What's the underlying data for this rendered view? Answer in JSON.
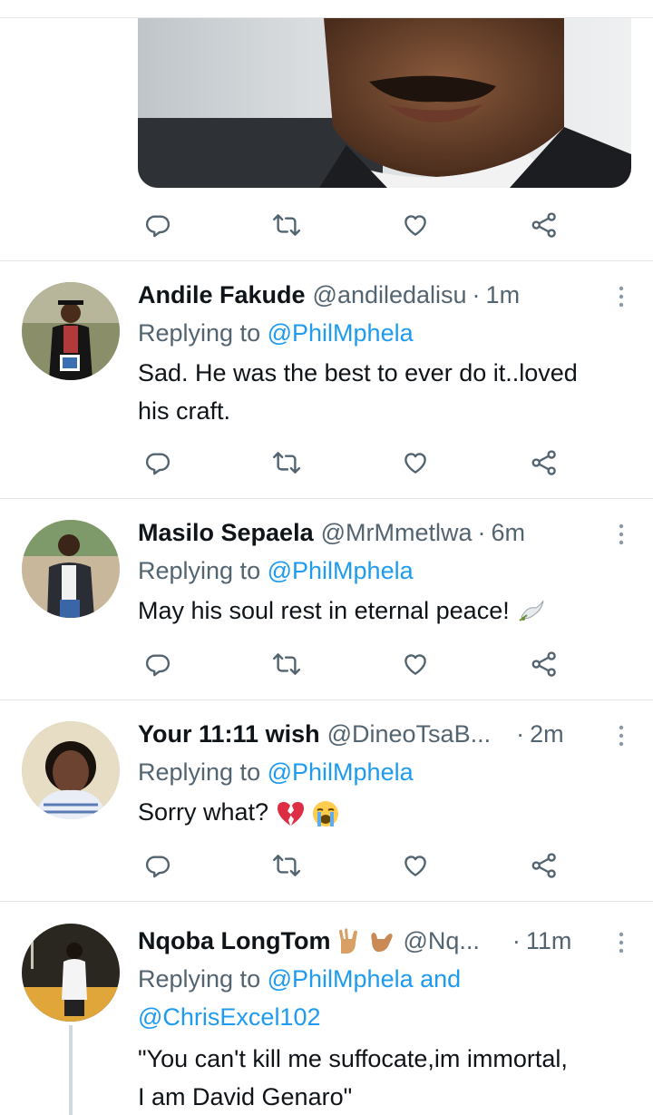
{
  "tweets": [
    {
      "name": "Andile Fakude",
      "handle": "@andiledalisu",
      "sep": "·",
      "time": "1m",
      "replying_prefix": "Replying to",
      "replying_to": "@PhilMphela",
      "text_line1": "Sad. He was the best to ever do it..loved",
      "text_line2": "his craft."
    },
    {
      "name": "Masilo Sepaela",
      "handle": "@MrMmetlwa",
      "sep": "·",
      "time": "6m",
      "replying_prefix": "Replying to",
      "replying_to": "@PhilMphela",
      "text_line1": "May his soul rest in eternal peace!",
      "emoji": "dove-emoji"
    },
    {
      "name": "Your 11:11 wish",
      "handle": "@DineoTsaB...",
      "sep": "·",
      "time": "2m",
      "replying_prefix": "Replying to",
      "replying_to": "@PhilMphela",
      "text_line1": "Sorry what?",
      "emoji": "broken-heart-and-crying-face-emoji"
    },
    {
      "name": "Nqoba LongTom",
      "handle": "@Nq...",
      "sep": "·",
      "time": "11m",
      "replying_prefix": "Replying to",
      "replying_to": "@PhilMphela",
      "replying_and": "and",
      "replying_to_2": "@ChrisExcel102",
      "text_line1": "\"You can't kill me suffocate,im immortal,",
      "text_line2": "I am David Genaro\"",
      "emoji": "hand-gesture-emoji"
    }
  ],
  "colors": {
    "accent": "#1d9bf0",
    "secondary_text": "#536471",
    "primary_text": "#0f1419",
    "divider": "#e1e5e8"
  },
  "icons": [
    "reply-icon",
    "retweet-icon",
    "like-icon",
    "share-icon",
    "more-options-icon"
  ]
}
